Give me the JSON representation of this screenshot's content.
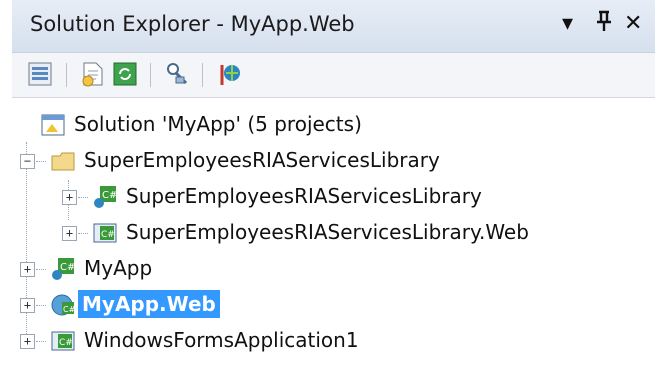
{
  "window": {
    "title": "Solution Explorer - MyApp.Web",
    "dropdown_glyph": "▾",
    "pin_glyph": "ᚿ",
    "close_glyph": "✕"
  },
  "toolbar": {
    "buttons": [
      {
        "name": "properties-button",
        "icon": "properties-icon"
      },
      {
        "name": "show-all-files-button",
        "icon": "show-all-files-icon"
      },
      {
        "name": "refresh-button",
        "icon": "refresh-icon"
      },
      {
        "name": "view-class-diagram-button",
        "icon": "class-diagram-icon"
      },
      {
        "name": "ria-services-button",
        "icon": "ria-link-icon"
      }
    ]
  },
  "tree": {
    "solution": "Solution 'MyApp' (5 projects)",
    "folder": "SuperEmployeesRIAServicesLibrary",
    "items": [
      {
        "label": "SuperEmployeesRIAServicesLibrary",
        "expander": "+"
      },
      {
        "label": "SuperEmployeesRIAServicesLibrary.Web",
        "expander": "+"
      },
      {
        "label": "MyApp",
        "expander": "+"
      },
      {
        "label": "MyApp.Web",
        "expander": "+",
        "selected": true
      },
      {
        "label": "WindowsFormsApplication1",
        "expander": "+"
      }
    ],
    "folder_expander": "−",
    "selection_color": "#3399ff"
  }
}
